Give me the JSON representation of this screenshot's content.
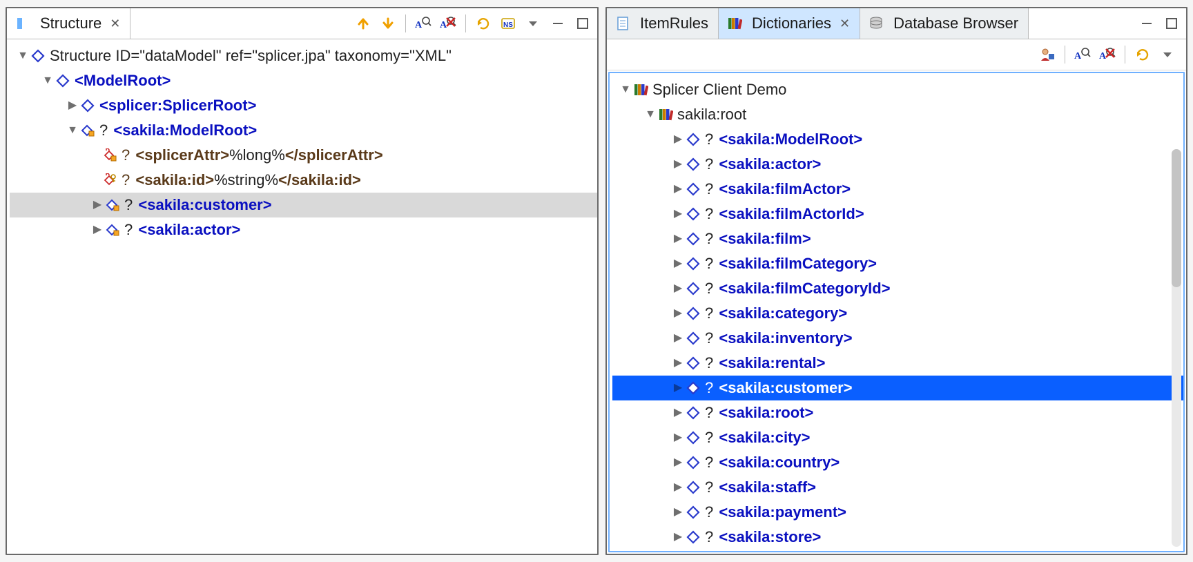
{
  "colors": {
    "xml_tag": "#0a10c0",
    "attr_text": "#5a3a1a",
    "selection_blue": "#0a5fff",
    "selection_grey": "#d9d9d9"
  },
  "left": {
    "tab": {
      "title": "Structure"
    },
    "toolbar": {
      "up": "up-arrow-icon",
      "down": "down-arrow-icon",
      "az_mag": "letters-magnifier-icon",
      "az_mag_x": "letters-magnifier-delete-icon",
      "refresh": "refresh-icon",
      "ns": "namespace-icon",
      "menu": "view-menu-icon",
      "minimize": "minimize-icon",
      "maximize": "maximize-icon"
    },
    "tree": {
      "root": {
        "prefix": "Structure ",
        "id_label": "ID=",
        "id_value": "\"dataModel\"",
        "ref_label": " ref=",
        "ref_value": "\"splicer.jpa\"",
        "tax_label": " taxonomy=",
        "tax_value": "\"XML\""
      },
      "modelRoot": "<ModelRoot>",
      "splicerRoot": "<splicer:SplicerRoot>",
      "sakilaModelRoot": "? <sakila:ModelRoot>",
      "attr1": {
        "open": "? <splicerAttr>",
        "val": "%long%",
        "close": "</splicerAttr>"
      },
      "attr2": {
        "open": "? <sakila:id>",
        "val": "%string%",
        "close": "</sakila:id>"
      },
      "sakilaCustomer": "? <sakila:customer>",
      "sakilaActor": "? <sakila:actor>"
    }
  },
  "right": {
    "tabs": {
      "itemRules": "ItemRules",
      "dictionaries": "Dictionaries",
      "dbBrowser": "Database Browser"
    },
    "toolbar2": {
      "user": "user-icon",
      "az_mag": "letters-magnifier-icon",
      "az_mag_x": "letters-magnifier-delete-icon",
      "refresh": "refresh-icon",
      "menu": "view-menu-icon"
    },
    "toolbar_top": {
      "minimize": "minimize-icon",
      "maximize": "maximize-icon"
    },
    "tree": {
      "root": "Splicer Client Demo",
      "sakilaRoot": "sakila:root",
      "items": [
        "? <sakila:ModelRoot>",
        "? <sakila:actor>",
        "? <sakila:filmActor>",
        "? <sakila:filmActorId>",
        "? <sakila:film>",
        "? <sakila:filmCategory>",
        "? <sakila:filmCategoryId>",
        "? <sakila:category>",
        "? <sakila:inventory>",
        "? <sakila:rental>",
        "? <sakila:customer>",
        "? <sakila:root>",
        "? <sakila:city>",
        "? <sakila:country>",
        "? <sakila:staff>",
        "? <sakila:payment>",
        "? <sakila:store>"
      ],
      "selected_index": 10
    }
  }
}
